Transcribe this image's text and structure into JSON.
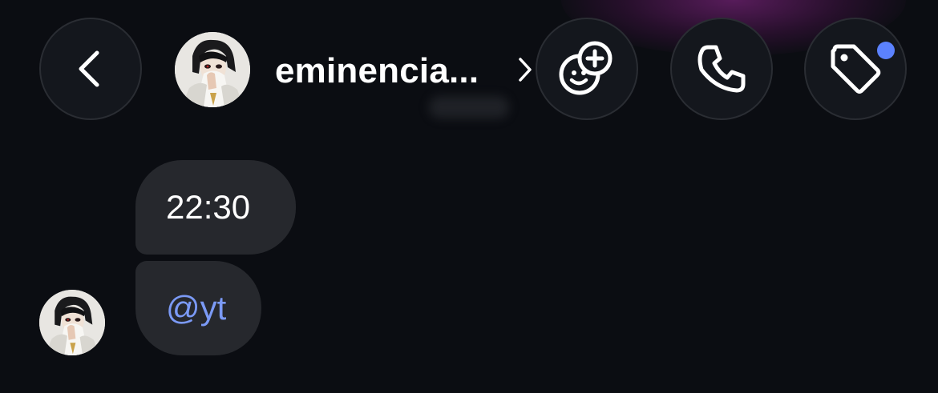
{
  "header": {
    "contact_name": "eminencia...",
    "back_icon": "chevron-left-icon",
    "name_chevron_icon": "chevron-right-icon",
    "actions": [
      {
        "name": "sticker-add",
        "icon": "sticker-plus-icon"
      },
      {
        "name": "call",
        "icon": "phone-icon"
      },
      {
        "name": "tag",
        "icon": "tag-icon",
        "has_notification": true
      }
    ]
  },
  "messages": [
    {
      "text": "22:30",
      "type": "text"
    },
    {
      "text": "@yt",
      "type": "mention"
    }
  ],
  "colors": {
    "background": "#0b0d12",
    "bubble": "#26282d",
    "mention": "#7b9af6",
    "notification_dot": "#5b82ff",
    "button_bg": "#14171d"
  }
}
